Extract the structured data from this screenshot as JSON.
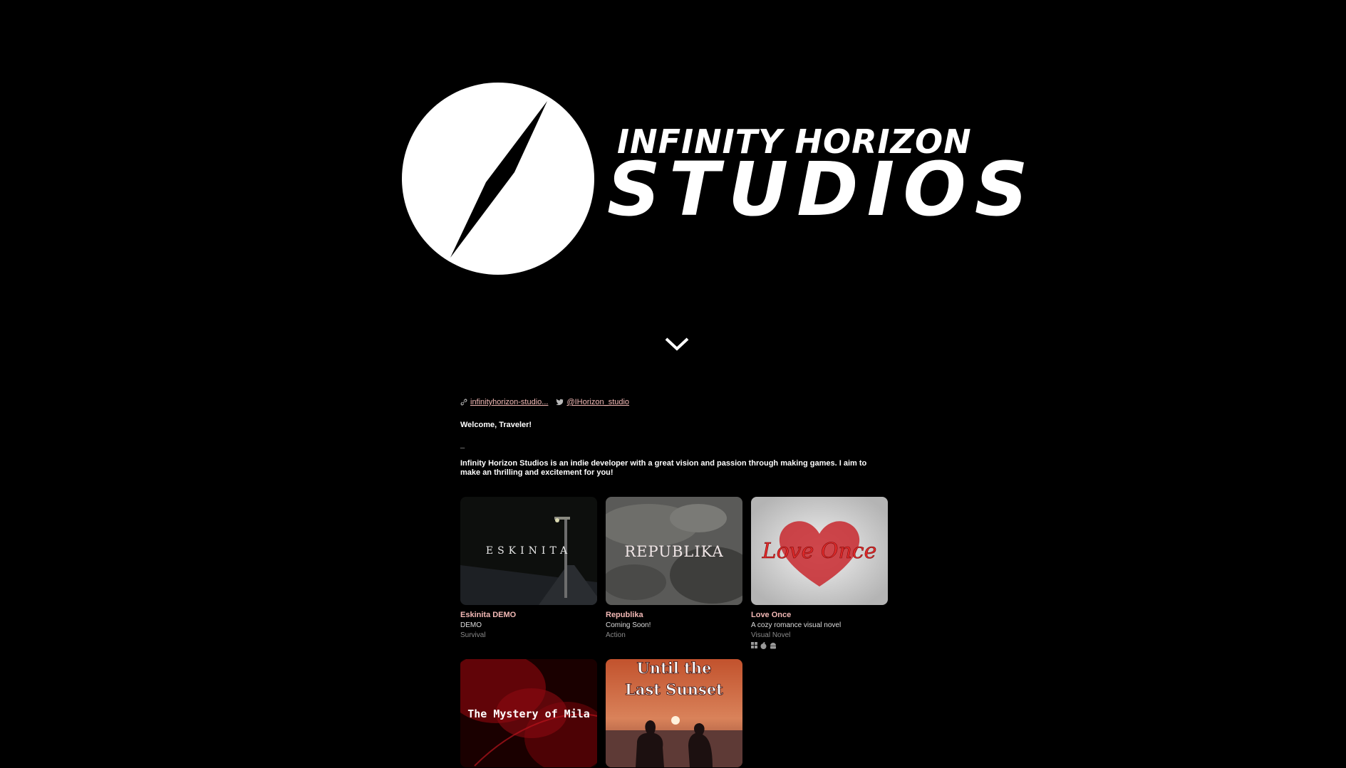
{
  "brand": {
    "line1": "INFINITY HORIZON",
    "line2": "STUDIOS"
  },
  "links": {
    "website": "infinityhorizon-studio...",
    "twitter": "@IHorizon_studio"
  },
  "about": {
    "welcome": "Welcome, Traveler!",
    "dash": "_",
    "intro": "Infinity Horizon Studios is an indie developer with a great vision and passion through making games. I aim to make an thrilling and excitement for you!"
  },
  "games": [
    {
      "title": "Eskinita DEMO",
      "desc": "DEMO",
      "genre": "Survival",
      "cover_text": "ESKINITA"
    },
    {
      "title": "Republika",
      "desc": "Coming Soon!",
      "genre": "Action",
      "cover_text": "REPUBLIKA"
    },
    {
      "title": "Love Once",
      "desc": "A cozy romance visual novel",
      "genre": "Visual Novel",
      "cover_text": "Love Once",
      "platforms": [
        "windows-icon",
        "apple-icon",
        "android-icon"
      ]
    },
    {
      "title": "",
      "desc": "",
      "genre": "",
      "cover_text": "The Mystery of Mila"
    },
    {
      "title": "",
      "desc": "",
      "genre": "",
      "cover_text_1": "Until the",
      "cover_text_2": "Last Sunset"
    }
  ],
  "colors": {
    "background": "#000000",
    "link": "#f2b8b5",
    "accent_red": "#c4141c"
  }
}
